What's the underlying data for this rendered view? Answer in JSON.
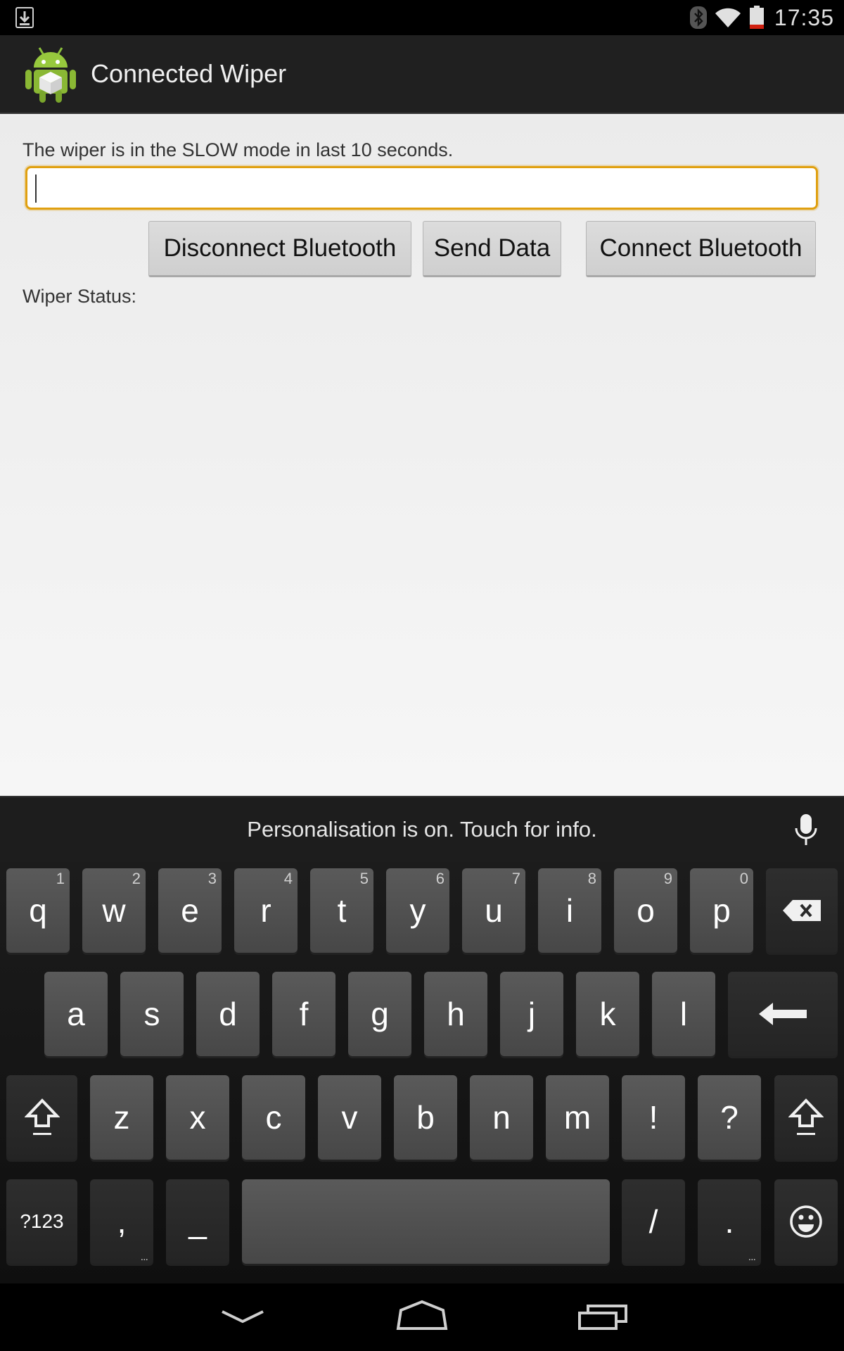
{
  "status_bar": {
    "time": "17:35"
  },
  "app": {
    "title": "Connected Wiper"
  },
  "main": {
    "status_message": "The wiper is in the SLOW mode in last 10 seconds.",
    "input_value": "",
    "buttons": {
      "disconnect": "Disconnect Bluetooth",
      "send": "Send Data",
      "connect": "Connect Bluetooth"
    },
    "wiper_status_label": "Wiper Status:"
  },
  "keyboard": {
    "suggestion": "Personalisation is on. Touch for info.",
    "row1": [
      "q",
      "w",
      "e",
      "r",
      "t",
      "y",
      "u",
      "i",
      "o",
      "p"
    ],
    "row1_hints": [
      "1",
      "2",
      "3",
      "4",
      "5",
      "6",
      "7",
      "8",
      "9",
      "0"
    ],
    "row2": [
      "a",
      "s",
      "d",
      "f",
      "g",
      "h",
      "j",
      "k",
      "l"
    ],
    "row3": [
      "z",
      "x",
      "c",
      "v",
      "b",
      "n",
      "m",
      "!",
      "?"
    ],
    "row4": {
      "symbols": "?123",
      "comma": ",",
      "underscore": "_",
      "slash": "/",
      "period": ".",
      "ellipsis": "..."
    }
  }
}
